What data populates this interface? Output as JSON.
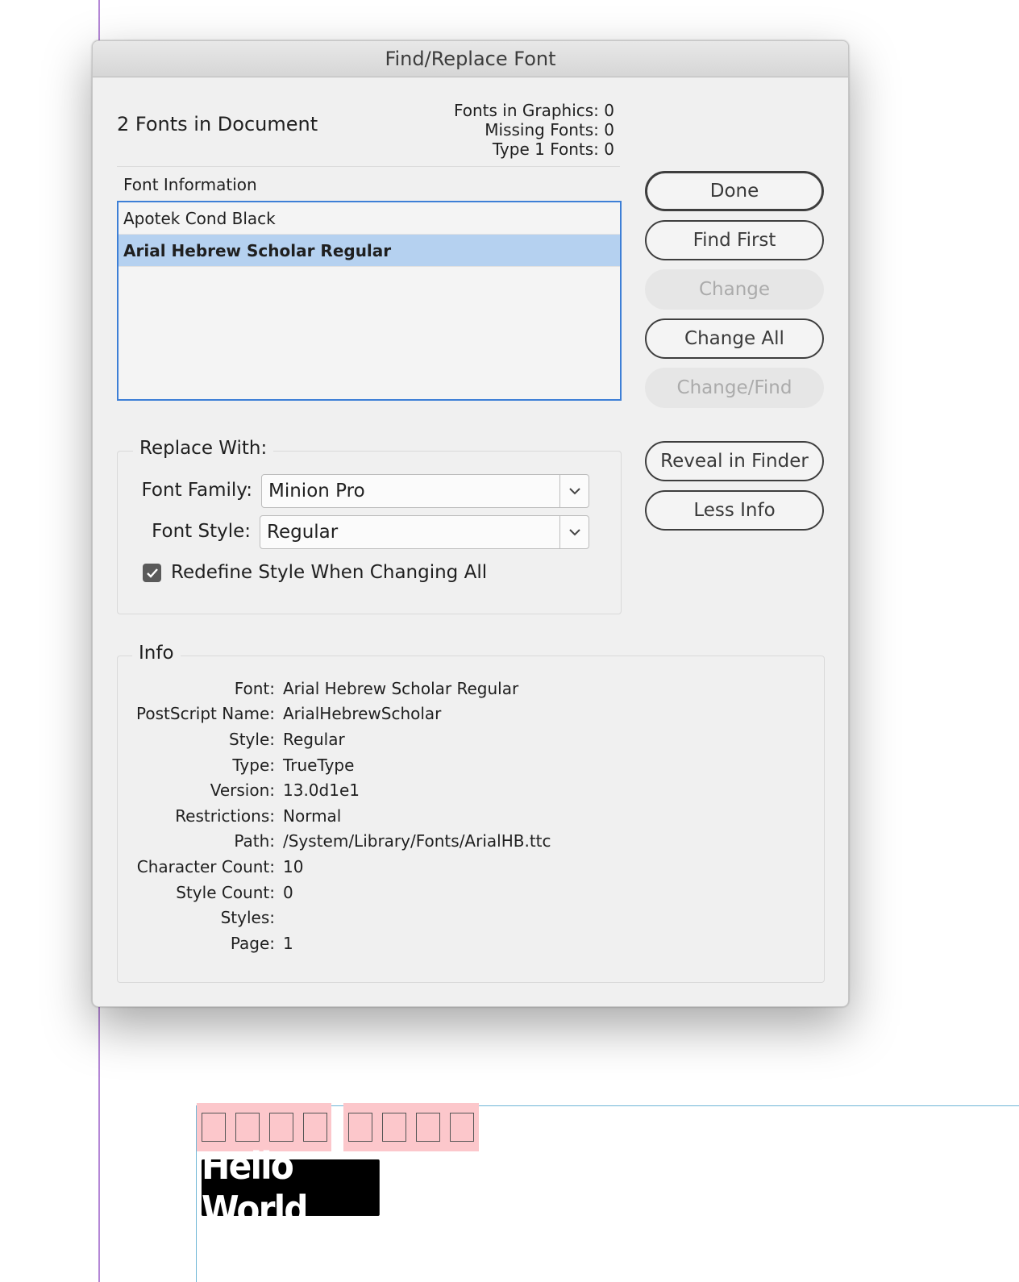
{
  "dialog": {
    "title": "Find/Replace Font",
    "fonts_in_document": "2 Fonts in Document",
    "stats": [
      {
        "label": "Fonts in Graphics: 0"
      },
      {
        "label": "Missing Fonts: 0"
      },
      {
        "label": "Type 1 Fonts: 0"
      }
    ],
    "font_information_label": "Font Information",
    "fonts": [
      {
        "name": "Apotek Cond Black",
        "selected": false
      },
      {
        "name": "Arial Hebrew Scholar Regular",
        "selected": true
      }
    ],
    "buttons": {
      "done": "Done",
      "find_first": "Find First",
      "change": "Change",
      "change_all": "Change All",
      "change_find": "Change/Find",
      "reveal_in_finder": "Reveal in Finder",
      "less_info": "Less Info"
    },
    "replace_with": {
      "legend": "Replace With:",
      "font_family_label": "Font Family:",
      "font_family_value": "Minion Pro",
      "font_style_label": "Font Style:",
      "font_style_value": "Regular",
      "redefine_label": "Redefine Style When Changing All",
      "redefine_checked": true
    },
    "info": {
      "legend": "Info",
      "rows": [
        {
          "key": "Font:",
          "value": "Arial Hebrew Scholar Regular"
        },
        {
          "key": "PostScript Name:",
          "value": "ArialHebrewScholar"
        },
        {
          "key": "Style:",
          "value": "Regular"
        },
        {
          "key": "Type:",
          "value": "TrueType"
        },
        {
          "key": "Version:",
          "value": "13.0d1e1"
        },
        {
          "key": "Restrictions:",
          "value": "Normal"
        },
        {
          "key": "Path:",
          "value": "/System/Library/Fonts/ArialHB.ttc"
        },
        {
          "key": "Character Count:",
          "value": "10"
        },
        {
          "key": "Style Count:",
          "value": "0"
        },
        {
          "key": "Styles:",
          "value": ""
        },
        {
          "key": "Page:",
          "value": "1"
        }
      ]
    }
  },
  "canvas": {
    "hello_text": "Hello World",
    "missing_glyph_color": "#fcc7cb",
    "selection_color": "#b5d1f0",
    "focus_color": "#3d7fd6"
  }
}
